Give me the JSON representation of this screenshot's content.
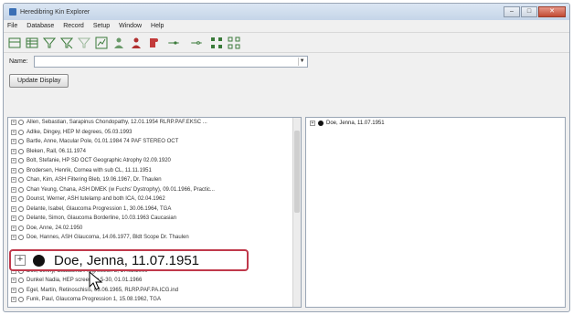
{
  "window": {
    "title": "Heredibring Kin Explorer"
  },
  "menu": [
    "File",
    "Database",
    "Record",
    "Setup",
    "Window",
    "Help"
  ],
  "toolbar_icons": [
    "tree-view-icon",
    "grid-view-icon",
    "filter-icon",
    "filter-clear-icon",
    "filter-alt-icon",
    "chart-icon",
    "user-icon",
    "users-icon",
    "person-red-icon",
    "link-icon",
    "link-alt-icon",
    "hierarchy-icon",
    "hierarchy-alt-icon"
  ],
  "name_field": {
    "label": "Name:",
    "value": ""
  },
  "update_button": "Update Display",
  "tree_rows_top": [
    "Allen, Sebastian,  Sarapinus Chondopathy,  12.01.1954  RLRP.PAF.EKSC ...",
    "Adlke, Dingey,  HEP M degrees,  05.03.1993",
    "Bartle, Anne,  Macular Pole,  01.01.1984 74 PAF STEREO OCT",
    "Bleken,  Rall,  06.11.1974",
    "Bolt, Stefanie,  HP SD OCT Geographic Atrophy  02.09.1920",
    "Brodersen, Henrik,  Cornea with sub CL,  11.11.1951",
    "Chan, Kim,  ASH Filtering Bleb,  19.06.1967, Dr. Thaulen",
    "Chan Yeung, Chana,  ASH DMEK (w Fuchs' Dystrophy),  09.01.1966, Practic...",
    "Dounst, Werner,  ASH tutelamp and both ICA,  02.04.1962",
    "Delante, Isabel,  Glaucoma Progression 1,  30.06.1964, TGA",
    "Delante, Simon,  Glaucoma Borderline,  10.03.1963  Caucasian",
    "Doe,  Anne,  24.02.1950",
    "Doe, Hannes,  ASH Glaucoma,  14.06.1977, Bldt Scope Dr. Thaulen"
  ],
  "highlighted_record": "Doe,  Jenna,  11.07.1951",
  "tree_rows_bottom": [
    "Doe, Jenny,  Glaucoma Progression 2,  17.02.2000",
    "Dunkel Nadia,  HEP screening 5-30,  01.01.1966",
    "Egel, Martin,  Retinoschisis,  03.06.1965, RLRP.PAF.PA.ICG.ind",
    "Funk, Paul,  Glaucoma Progression 1,  15.08.1962, TGA"
  ],
  "right_pane_node": "Doe,  Jenna,  11.07.1951"
}
